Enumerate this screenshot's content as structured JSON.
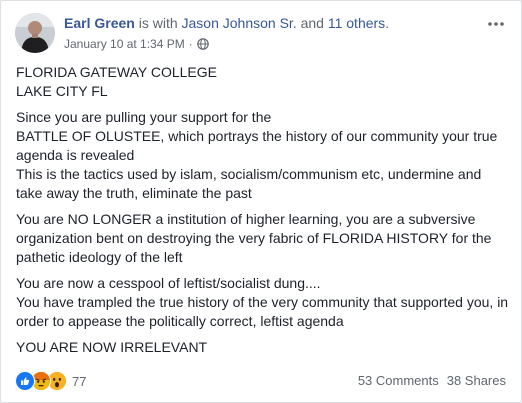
{
  "header": {
    "author": "Earl Green",
    "with_text": " is with ",
    "tagged_person": "Jason Johnson Sr.",
    "and_text": " and ",
    "others": "11 others",
    "period": ".",
    "timestamp": "January 10 at 1:34 PM",
    "separator": "·",
    "privacy_icon": "globe-icon",
    "menu_icon": "more-dots-icon"
  },
  "post": {
    "lines": [
      [
        "FLORIDA GATEWAY COLLEGE",
        "LAKE CITY FL"
      ],
      [
        "Since you are pulling your support for the",
        "BATTLE OF OLUSTEE, which portrays the history of our community your true agenda is revealed",
        "This is the tactics used by islam, socialism/communism etc, undermine and take away the truth, eliminate the past"
      ],
      [
        "You are NO LONGER a institution of higher learning, you are a subversive organization bent on destroying the very fabric of FLORIDA HISTORY for the pathetic ideology of the left"
      ],
      [
        "You are now a cesspool of leftist/socialist dung....",
        "You have trampled the true history of the very community that supported you, in order to appease the politically correct, leftist agenda"
      ],
      [
        "YOU ARE NOW IRRELEVANT"
      ]
    ]
  },
  "footer": {
    "reaction_icons": [
      "like-icon",
      "angry-icon",
      "wow-icon"
    ],
    "reaction_count": "77",
    "comments": "53 Comments",
    "shares": "38 Shares"
  },
  "colors": {
    "link": "#385898",
    "text": "#1d2129",
    "muted": "#616770",
    "like_blue": "#1877f2",
    "angry": "#e9710f",
    "wow": "#f7b125"
  }
}
